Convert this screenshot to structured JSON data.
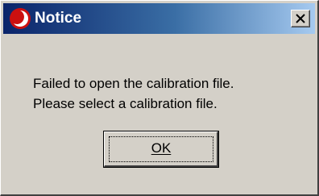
{
  "window": {
    "title": "Notice",
    "icon": "app-logo-icon",
    "close_icon": "close-icon"
  },
  "message": {
    "line1": "Failed to open the calibration file.",
    "line2": "Please select a calibration file."
  },
  "buttons": {
    "ok_label": "OK"
  },
  "colors": {
    "titlebar_start": "#0a246a",
    "titlebar_end": "#a6caf0",
    "dialog_background": "#d4d0c8",
    "icon_red": "#cc1010"
  }
}
